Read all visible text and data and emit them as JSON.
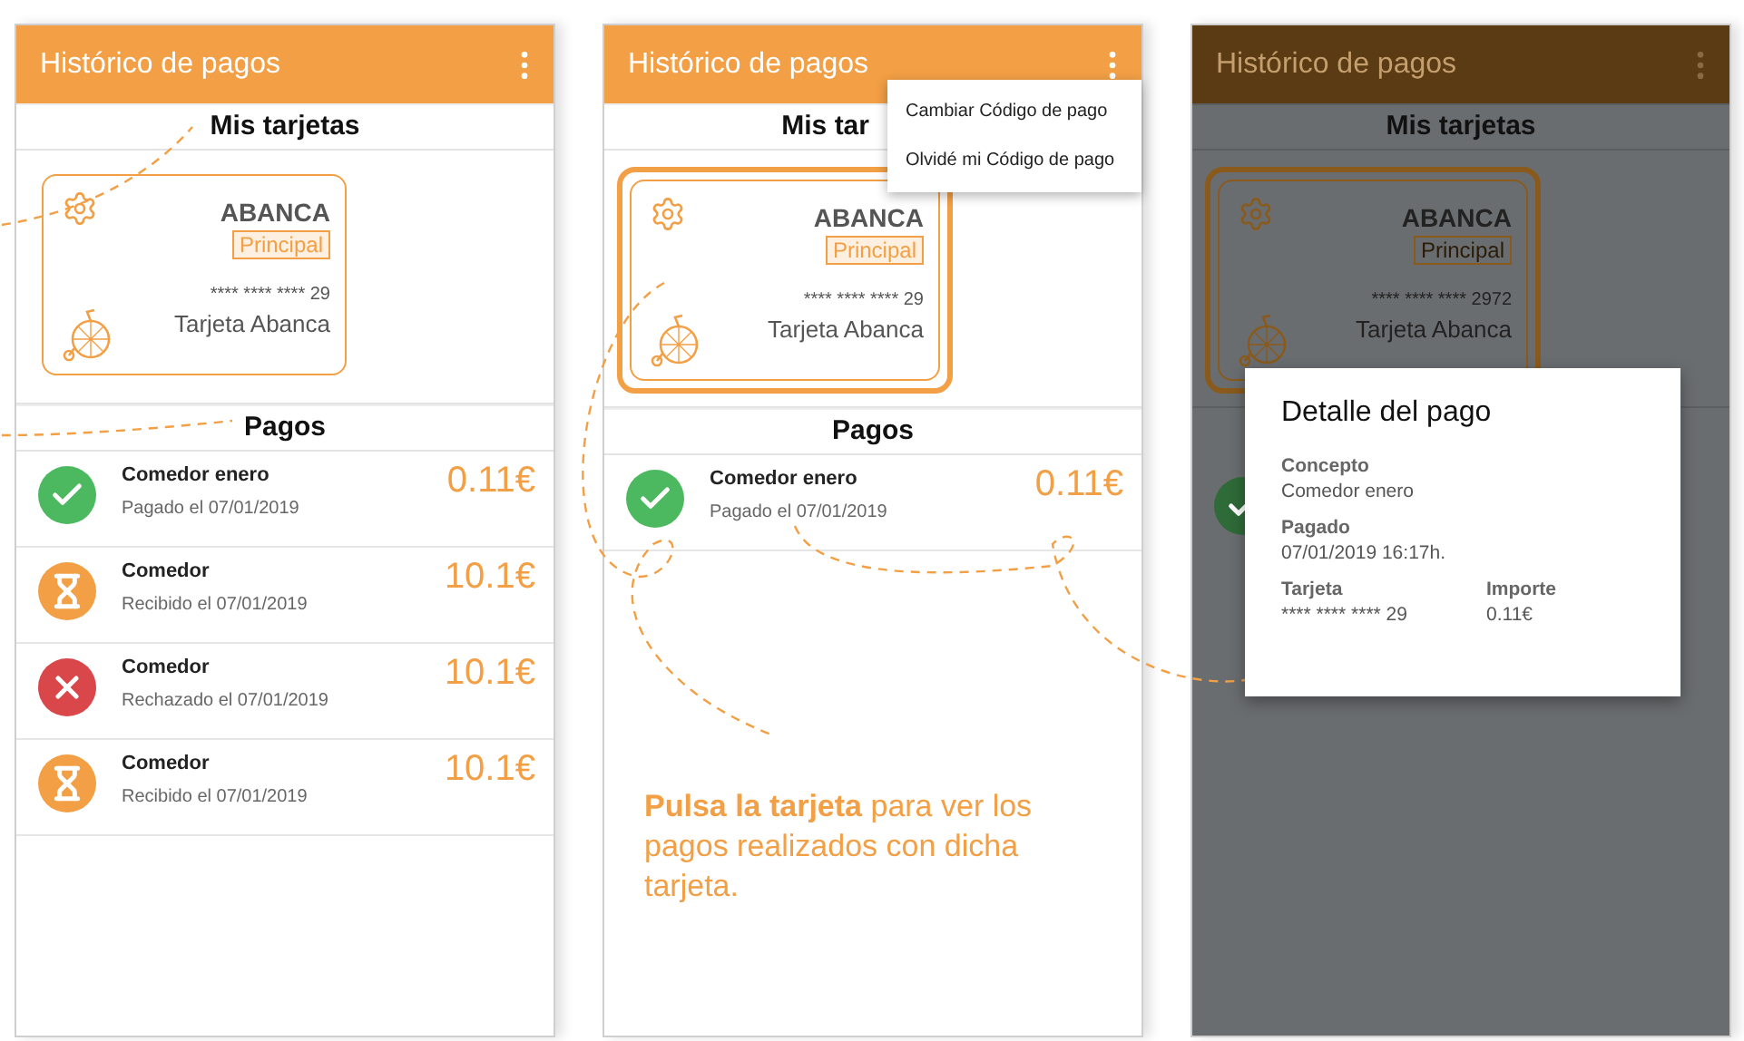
{
  "screens": [
    {
      "title": "Histórico de pagos",
      "dimmed": false,
      "cards_heading": "Mis tarjetas",
      "card": {
        "bank": "ABANCA",
        "badge": "Principal",
        "number": "**** **** **** 29",
        "name": "Tarjeta Abanca",
        "selected": false
      },
      "payments_heading": "Pagos",
      "payments": [
        {
          "kind": "paid",
          "title": "Comedor enero",
          "subtitle": "Pagado el 07/01/2019",
          "amount": "0.11€"
        },
        {
          "kind": "pending",
          "title": "Comedor",
          "subtitle": "Recibido el 07/01/2019",
          "amount": "10.1€"
        },
        {
          "kind": "rejected",
          "title": "Comedor",
          "subtitle": "Rechazado el 07/01/2019",
          "amount": "10.1€"
        },
        {
          "kind": "pending",
          "title": "Comedor",
          "subtitle": "Recibido el 07/01/2019",
          "amount": "10.1€"
        }
      ]
    },
    {
      "title": "Histórico de pagos",
      "dimmed": false,
      "cards_heading": "Mis tar",
      "card": {
        "bank": "ABANCA",
        "badge": "Principal",
        "number": "**** **** **** 29",
        "name": "Tarjeta Abanca",
        "selected": true
      },
      "payments_heading": "Pagos",
      "payments": [
        {
          "kind": "paid",
          "title": "Comedor enero",
          "subtitle": "Pagado el 07/01/2019",
          "amount": "0.11€"
        }
      ],
      "menu": [
        "Cambiar Código de pago",
        "Olvidé mi Código de pago"
      ],
      "caption": "**Pulsa la tarjeta** para ver los pagos realizados con dicha tarjeta."
    },
    {
      "title": "Histórico de pagos",
      "dimmed": true,
      "cards_heading": "Mis tarjetas",
      "card": {
        "bank": "ABANCA",
        "badge": "Principal",
        "number": "**** **** **** 2972",
        "name": "Tarjeta Abanca",
        "selected": true
      },
      "payments": [
        {
          "kind": "paid"
        }
      ],
      "dialog": {
        "title": "Detalle del pago",
        "fields": [
          {
            "label": "Concepto",
            "value": "Comedor enero"
          },
          {
            "label": "Pagado",
            "value": "07/01/2019 16:17h."
          }
        ],
        "pair": [
          {
            "label": "Tarjeta",
            "value": "**** **** **** 29"
          },
          {
            "label": "Importe",
            "value": "0.11€"
          }
        ]
      }
    }
  ]
}
